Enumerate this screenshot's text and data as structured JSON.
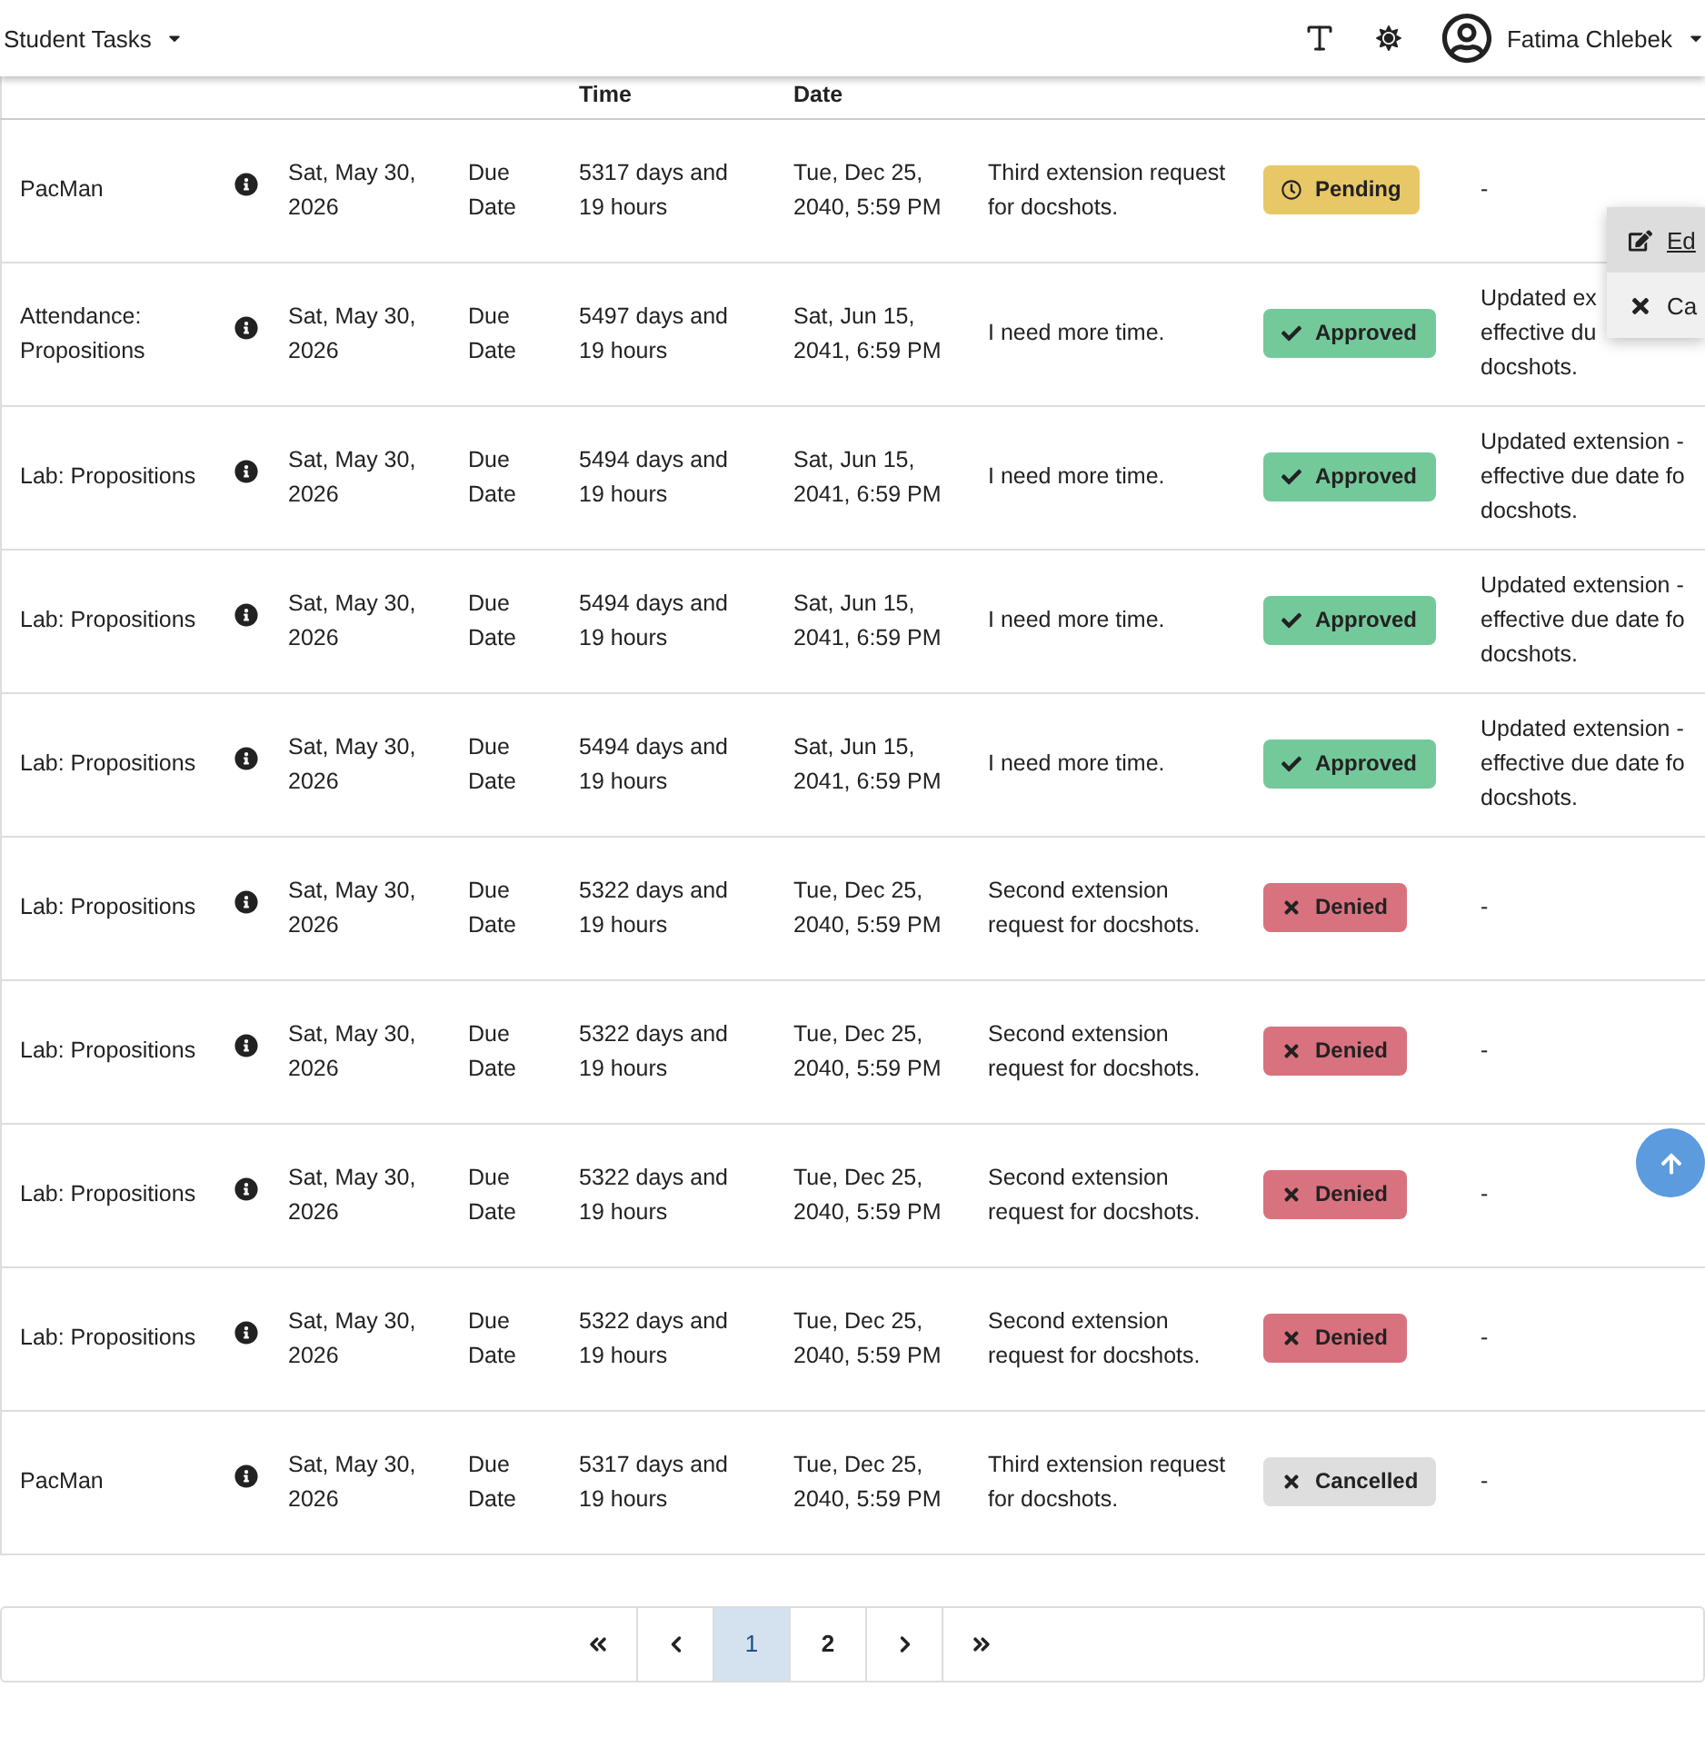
{
  "navbar": {
    "title": "Student Tasks",
    "user_name": "Fatima Chlebek"
  },
  "table": {
    "columns": [
      {
        "label": "Time"
      },
      {
        "label": "Date"
      }
    ],
    "rows": [
      {
        "name": "PacMan",
        "start": "Sat, May 30, 2026",
        "type": "Due Date",
        "time": "5317 days and 19 hours",
        "due": "Tue, Dec 25, 2040, 5:59 PM",
        "reason": "Third extension request for docshots.",
        "status": {
          "kind": "pending",
          "label": "Pending"
        },
        "note": "-"
      },
      {
        "name": "Attendance: Propositions",
        "start": "Sat, May 30, 2026",
        "type": "Due Date",
        "time": "5497 days and 19 hours",
        "due": "Sat, Jun 15, 2041, 6:59 PM",
        "reason": "I need more time.",
        "status": {
          "kind": "approved",
          "label": "Approved"
        },
        "note": "Updated ex\neffective du\ndocshots."
      },
      {
        "name": "Lab: Propositions",
        "start": "Sat, May 30, 2026",
        "type": "Due Date",
        "time": "5494 days and 19 hours",
        "due": "Sat, Jun 15, 2041, 6:59 PM",
        "reason": "I need more time.",
        "status": {
          "kind": "approved",
          "label": "Approved"
        },
        "note": "Updated extension -\neffective due date fo\ndocshots."
      },
      {
        "name": "Lab: Propositions",
        "start": "Sat, May 30, 2026",
        "type": "Due Date",
        "time": "5494 days and 19 hours",
        "due": "Sat, Jun 15, 2041, 6:59 PM",
        "reason": "I need more time.",
        "status": {
          "kind": "approved",
          "label": "Approved"
        },
        "note": "Updated extension -\neffective due date fo\ndocshots."
      },
      {
        "name": "Lab: Propositions",
        "start": "Sat, May 30, 2026",
        "type": "Due Date",
        "time": "5494 days and 19 hours",
        "due": "Sat, Jun 15, 2041, 6:59 PM",
        "reason": "I need more time.",
        "status": {
          "kind": "approved",
          "label": "Approved"
        },
        "note": "Updated extension -\neffective due date fo\ndocshots."
      },
      {
        "name": "Lab: Propositions",
        "start": "Sat, May 30, 2026",
        "type": "Due Date",
        "time": "5322 days and 19 hours",
        "due": "Tue, Dec 25, 2040, 5:59 PM",
        "reason": "Second extension request for docshots.",
        "status": {
          "kind": "denied",
          "label": "Denied"
        },
        "note": "-"
      },
      {
        "name": "Lab: Propositions",
        "start": "Sat, May 30, 2026",
        "type": "Due Date",
        "time": "5322 days and 19 hours",
        "due": "Tue, Dec 25, 2040, 5:59 PM",
        "reason": "Second extension request for docshots.",
        "status": {
          "kind": "denied",
          "label": "Denied"
        },
        "note": "-"
      },
      {
        "name": "Lab: Propositions",
        "start": "Sat, May 30, 2026",
        "type": "Due Date",
        "time": "5322 days and 19 hours",
        "due": "Tue, Dec 25, 2040, 5:59 PM",
        "reason": "Second extension request for docshots.",
        "status": {
          "kind": "denied",
          "label": "Denied"
        },
        "note": "-"
      },
      {
        "name": "Lab: Propositions",
        "start": "Sat, May 30, 2026",
        "type": "Due Date",
        "time": "5322 days and 19 hours",
        "due": "Tue, Dec 25, 2040, 5:59 PM",
        "reason": "Second extension request for docshots.",
        "status": {
          "kind": "denied",
          "label": "Denied"
        },
        "note": "-"
      },
      {
        "name": "PacMan",
        "start": "Sat, May 30, 2026",
        "type": "Due Date",
        "time": "5317 days and 19 hours",
        "due": "Tue, Dec 25, 2040, 5:59 PM",
        "reason": "Third extension request for docshots.",
        "status": {
          "kind": "cancelled",
          "label": "Cancelled"
        },
        "note": "-"
      }
    ]
  },
  "context_menu": {
    "items": [
      {
        "kind": "edit",
        "label": "Ed",
        "selected": true
      },
      {
        "kind": "cancel",
        "label": "Ca",
        "selected": false
      }
    ]
  },
  "pagination": {
    "pages": [
      {
        "label": "1",
        "selected": true
      },
      {
        "label": "2",
        "selected": false
      }
    ]
  }
}
